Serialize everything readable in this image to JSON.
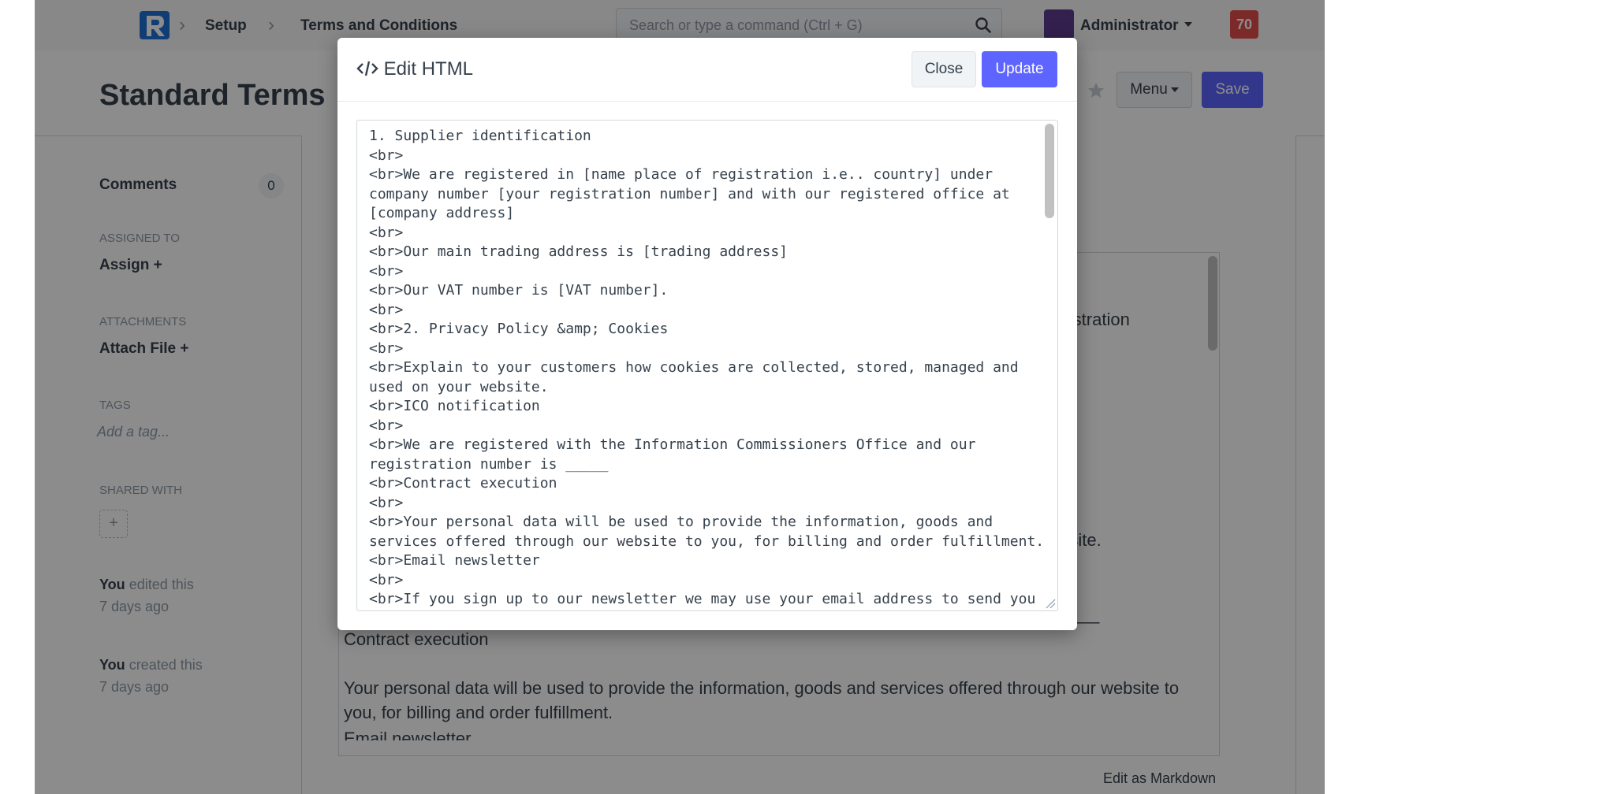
{
  "navbar": {
    "breadcrumbs": [
      "Setup",
      "Terms and Conditions"
    ],
    "search_placeholder": "Search or type a command (Ctrl + G)",
    "user_name": "Administrator",
    "notifications_count": "70"
  },
  "page": {
    "title": "Standard Terms",
    "menu_label": "Menu",
    "save_label": "Save"
  },
  "sidebar": {
    "comments_label": "Comments",
    "comments_count": "0",
    "assigned_to_label": "ASSIGNED TO",
    "assign_label": "Assign +",
    "attachments_label": "ATTACHMENTS",
    "attach_label": "Attach File +",
    "tags_label": "TAGS",
    "tag_placeholder": "Add a tag...",
    "shared_with_label": "SHARED WITH",
    "shared_add": "+",
    "edited_actor": "You",
    "edited_action": "edited this",
    "edited_time": "7 days ago",
    "created_actor": "You",
    "created_action": "created this",
    "created_time": "7 days ago"
  },
  "editor": {
    "visible_fragments": {
      "registration": "registration",
      "website": "website.",
      "blank": "s _____",
      "contract": "Contract execution",
      "personal_line1": "Your personal data will be used to provide the information, goods and services offered through our website to",
      "personal_line2": "you, for billing and order fulfillment.",
      "email_partial": "Email newsletter"
    },
    "edit_as_markdown": "Edit as Markdown"
  },
  "modal": {
    "title": "Edit HTML",
    "close_label": "Close",
    "update_label": "Update",
    "code_lines": [
      "1. Supplier identification",
      "<br>",
      "<br>We are registered in [name place of registration i.e.. country] under",
      "company number [your registration number] and with our registered office at",
      "[company address]",
      "<br>",
      "<br>Our main trading address is [trading address]",
      "<br>",
      "<br>Our VAT number is [VAT number].",
      "<br>",
      "<br>2. Privacy Policy &amp; Cookies",
      "<br>",
      "<br>Explain to your customers how cookies are collected, stored, managed and",
      "used on your website.",
      "<br>ICO notification",
      "<br>",
      "<br>We are registered with the Information Commissioners Office and our",
      "registration number is _____",
      "<br>Contract execution",
      "<br>",
      "<br>Your personal data will be used to provide the information, goods and",
      "services offered through our website to you, for billing and order fulfillment.",
      "<br>Email newsletter",
      "<br>",
      "<br>If you sign up to our newsletter we may use your email address to send you"
    ]
  },
  "colors": {
    "primary": "#5e64ff",
    "text": "#36414c",
    "muted": "#8d99a6",
    "notification": "#e24c4c",
    "border": "#d1d8dd"
  },
  "icons": [
    "logo-icon",
    "chevron-right-icon",
    "search-icon",
    "avatar",
    "caret-down-icon",
    "print-icon",
    "star-icon",
    "code-icon",
    "resize-grip-icon"
  ]
}
